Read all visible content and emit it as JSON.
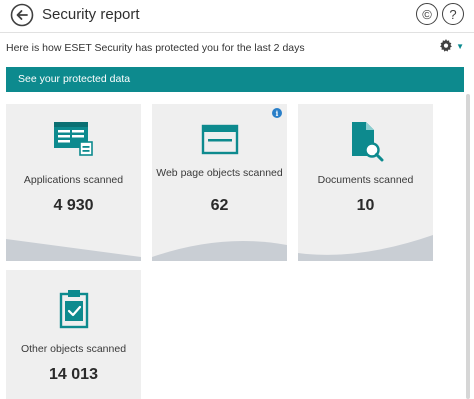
{
  "window": {
    "title": "Security report"
  },
  "header": {
    "subtitle": "Here is how ESET Security has protected you for the last 2 days"
  },
  "banner": {
    "label": "See your protected data"
  },
  "tiles": [
    {
      "label": "Applications scanned",
      "count": "4 930",
      "icon": "application-window-icon"
    },
    {
      "label": "Web page objects scanned",
      "count": "62",
      "icon": "browser-window-icon",
      "info": true
    },
    {
      "label": "Documents scanned",
      "count": "10",
      "icon": "document-search-icon"
    },
    {
      "label": "Other objects scanned",
      "count": "14 013",
      "icon": "clipboard-check-icon"
    }
  ],
  "colors": {
    "accent": "#0d8a8e",
    "tile_bg": "#efefef",
    "wave": "#c9ced4",
    "info": "#2a7fc8"
  }
}
